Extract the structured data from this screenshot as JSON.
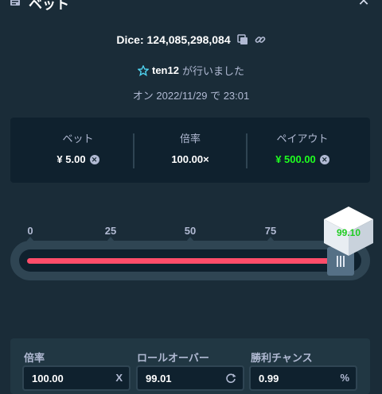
{
  "header": {
    "title": "ベット",
    "close_icon": "close-icon",
    "bet_icon": "bet-slip-icon"
  },
  "game": {
    "label": "Dice: 124,085,298,084",
    "copy_icon": "copy-icon",
    "link_icon": "link-icon"
  },
  "placed_by": {
    "user": "ten12",
    "suffix": "が行いました",
    "user_icon": "star-badge-icon"
  },
  "placed_at": "オン 2022/11/29 で 23:01",
  "stats": {
    "bet": {
      "label": "ベット",
      "value": "¥ 5.00"
    },
    "multiplier": {
      "label": "倍率",
      "value": "100.00×"
    },
    "payout": {
      "label": "ペイアウト",
      "value": "¥ 500.00"
    },
    "currency_icon": "currency-coin-icon"
  },
  "slider": {
    "ticks": [
      "0",
      "25",
      "50",
      "75"
    ],
    "roll_over": 99.01,
    "result": "99.10"
  },
  "fields": {
    "multiplier": {
      "label": "倍率",
      "value": "100.00",
      "suffix": "X"
    },
    "roll_over": {
      "label": "ロールオーバー",
      "value": "99.01",
      "icon": "refresh-icon"
    },
    "win_chance": {
      "label": "勝利チャンス",
      "value": "0.99",
      "suffix": "%"
    }
  },
  "colors": {
    "background": "#1a2c38",
    "panel": "#0f212e",
    "lose_red": "#ff4d6a",
    "win_green": "#1fff20",
    "muted_text": "#b1bad3"
  }
}
